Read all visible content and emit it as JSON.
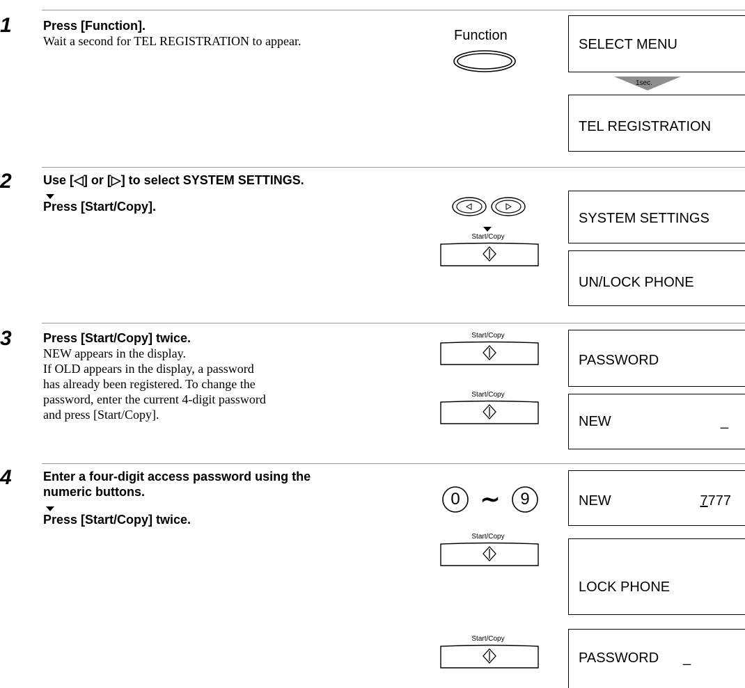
{
  "steps": [
    {
      "number": "1",
      "title": "Press [Function].",
      "body": "Wait a second for TEL REGISTRATION to appear.",
      "button_label": "Function",
      "display": [
        "SELECT MENU",
        "TEL REGISTRATION"
      ],
      "delay_label": "1sec."
    },
    {
      "number": "2",
      "title": "Use [◁] or [▷] to select SYSTEM SETTINGS.",
      "title_line2": "Press [Start/Copy].",
      "button_label": "Start/Copy",
      "display": [
        "SYSTEM SETTINGS",
        "UN/LOCK PHONE"
      ]
    },
    {
      "number": "3",
      "title": "Press [Start/Copy] twice.",
      "body_lines": [
        "NEW appears in the display.",
        "If OLD appears in the display, a password",
        "has already been registered. To change the",
        "password, enter the current 4-digit password",
        "and press [Start/Copy]."
      ],
      "button_labels": [
        "Start/Copy",
        "Start/Copy"
      ],
      "display": [
        {
          "text": "PASSWORD",
          "value": ""
        },
        {
          "text": "NEW",
          "value": "_"
        }
      ]
    },
    {
      "number": "4",
      "title_lines": [
        "Enter a four-digit access password using the",
        "numeric  buttons."
      ],
      "title_line2": "Press [Start/Copy] twice.",
      "keys": {
        "from": "0",
        "tilde": "∼",
        "to": "9"
      },
      "button_labels": [
        "Start/Copy",
        "Start/Copy"
      ],
      "display": [
        {
          "text": "NEW",
          "value_first": "7",
          "value_rest": "777"
        },
        {
          "text": "LOCK PHONE"
        },
        {
          "text": "PASSWORD",
          "value": "_"
        }
      ]
    }
  ],
  "icons": [
    "function-button-icon",
    "left-arrow-button-icon",
    "right-arrow-button-icon",
    "start-copy-button-icon",
    "down-arrow-icon",
    "numeric-key-icon"
  ]
}
